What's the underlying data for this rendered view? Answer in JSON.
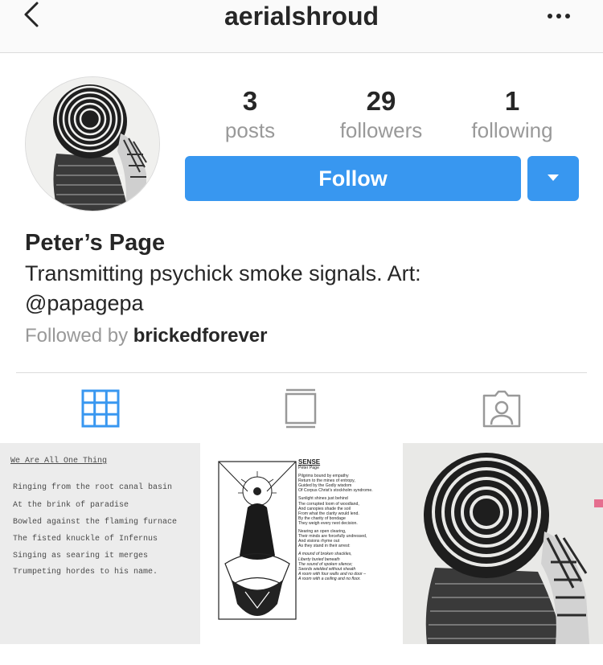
{
  "nav": {
    "username": "aerialshroud",
    "back_icon": "chevron-left-icon",
    "more_icon": "more-horizontal-icon"
  },
  "profile": {
    "stats": [
      {
        "count": "3",
        "label": "posts"
      },
      {
        "count": "29",
        "label": "followers"
      },
      {
        "count": "1",
        "label": "following"
      }
    ],
    "follow_label": "Follow",
    "name": "Peter’s Page",
    "bio": "Transmitting psychick smoke signals. Art: @papagepa",
    "followed_by_prefix": "Followed by",
    "followed_by_user": "brickedforever"
  },
  "tabs": [
    {
      "icon": "grid-icon",
      "active": true
    },
    {
      "icon": "feed-icon",
      "active": false
    },
    {
      "icon": "tagged-icon",
      "active": false
    }
  ],
  "posts": {
    "post1": {
      "title": "We Are All One Thing",
      "lines": [
        "Ringing from the root canal basin",
        "At the brink of paradise",
        "Bowled against the flaming furnace",
        "The fisted knuckle of Infernus",
        "Singing as searing it merges",
        "Trumpeting hordes to his name."
      ]
    },
    "post2": {
      "title": "SENSE",
      "author": "Peter Page",
      "stanzas": [
        [
          "Pilgrims bound by empathy",
          "Return to the mines of entropy,",
          "Guided by the Godly wisdom",
          "Of Corpus Christ's stockholm syndrome."
        ],
        [
          "Sunlight shines just behind",
          "The corrupted loom of woodland,",
          "And canopies shade the soil",
          "From what the clarity would lend.",
          "By the charity of bondage",
          "They weigh every next decision."
        ],
        [
          "Nearing an open clearing,",
          "Their minds are forcefully undressed,",
          "And visions rhyme out",
          "As they stand in their arrest:"
        ],
        [
          "A mound of broken shackles,",
          "Liberty buried beneath",
          "The sound of spoken silence;",
          "Swords wielded without sheath",
          "A room with four walls and no door –",
          "A room with a ceiling and no floor."
        ]
      ]
    }
  },
  "colors": {
    "accent": "#3897f0",
    "text": "#262626",
    "muted": "#999999",
    "divider": "#dbdbdb"
  }
}
